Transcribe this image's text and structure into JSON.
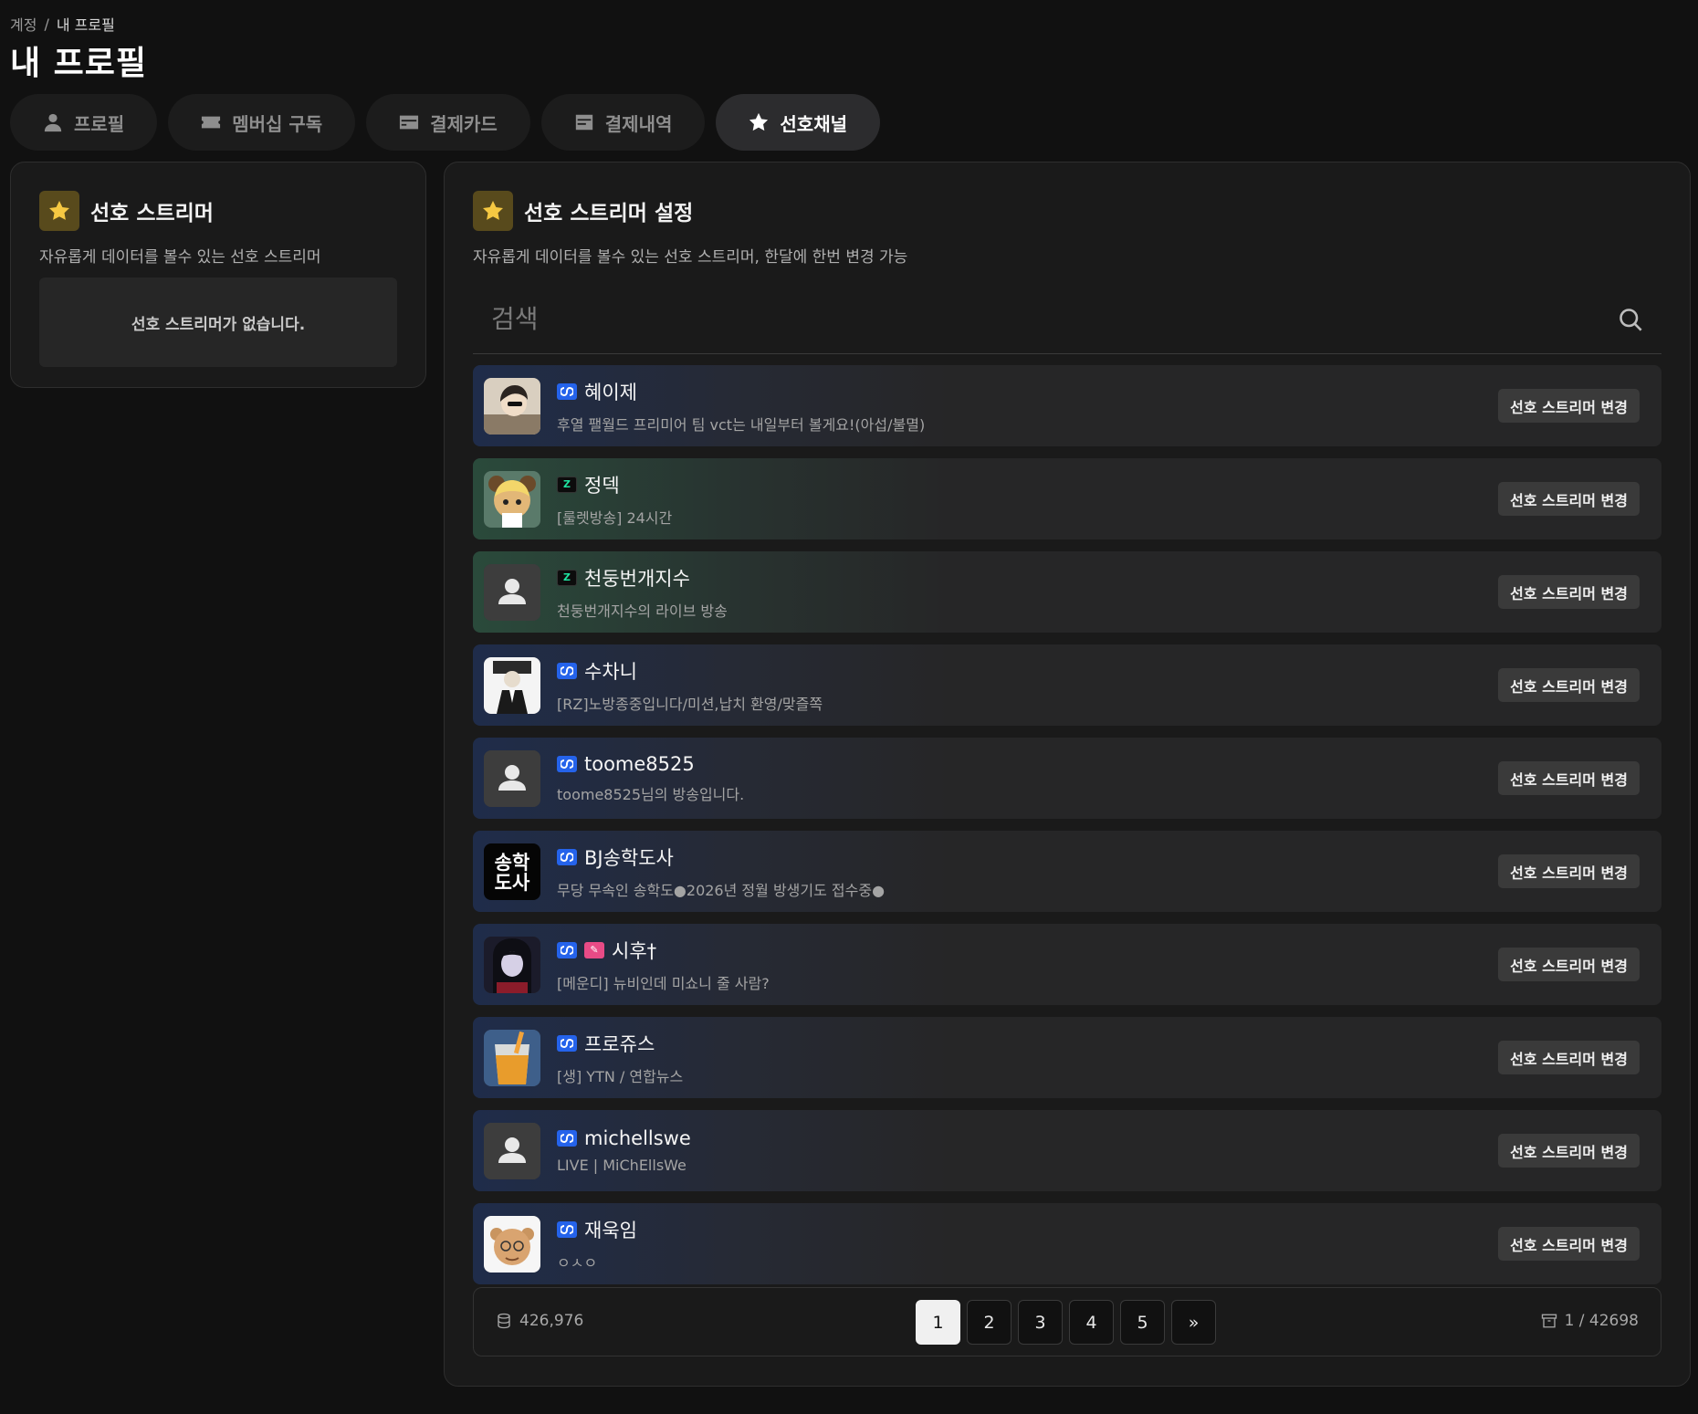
{
  "breadcrumb": {
    "parent": "계정",
    "separator": "/",
    "current": "내 프로필"
  },
  "page_title": "내 프로필",
  "tabs": [
    {
      "label": "프로필",
      "icon": "user-icon"
    },
    {
      "label": "멤버십 구독",
      "icon": "ticket-icon"
    },
    {
      "label": "결제카드",
      "icon": "credit-card-icon"
    },
    {
      "label": "결제내역",
      "icon": "receipt-icon"
    },
    {
      "label": "선호채널",
      "icon": "star-icon",
      "active": true
    }
  ],
  "left_panel": {
    "title": "선호 스트리머",
    "subtitle": "자유롭게 데이터를 볼수 있는 선호 스트리머",
    "empty_message": "선호 스트리머가 없습니다."
  },
  "right_panel": {
    "title": "선호 스트리머 설정",
    "subtitle": "자유롭게 데이터를 볼수 있는 선호 스트리머, 한달에 한번 변경 가능",
    "search_placeholder": "검색",
    "change_label": "선호 스트리머 변경",
    "streamers": [
      {
        "name": "혜이제",
        "desc": "후열 팰월드 프리미어 팀 vct는 내일부터 볼게요!(아섭/불멸)",
        "platform": "soop"
      },
      {
        "name": "정덱",
        "desc": "[룰렛방송] 24시간",
        "platform": "chzzk"
      },
      {
        "name": "천둥번개지수",
        "desc": "천둥번개지수의 라이브 방송",
        "platform": "chzzk"
      },
      {
        "name": "수차니",
        "desc": "[RZ]노방종중입니다/미션,납치 환영/맞즐쪽",
        "platform": "soop"
      },
      {
        "name": "toome8525",
        "desc": "toome8525님의 방송입니다.",
        "platform": "soop"
      },
      {
        "name": "BJ송학도사",
        "desc": "무당 무속인 송학도●2026년 정월 방생기도 접수중●",
        "platform": "soop",
        "avatar_text": [
          "송학",
          "도사"
        ]
      },
      {
        "name": "시후†",
        "desc": "[메운디] 뉴비인데 미쇼니 줄 사람?",
        "platform": "soop"
      },
      {
        "name": "프로쥬스",
        "desc": "[생] YTN / 연합뉴스",
        "platform": "soop"
      },
      {
        "name": "michellswe",
        "desc": "LIVE | MiChEllsWe",
        "platform": "soop"
      },
      {
        "name": "재욱임",
        "desc": "ㅇㅅㅇ",
        "platform": "soop"
      }
    ]
  },
  "pagination": {
    "total_count": "426,976",
    "pages": [
      "1",
      "2",
      "3",
      "4",
      "5"
    ],
    "next": "»",
    "page_status": "1 / 42698"
  }
}
